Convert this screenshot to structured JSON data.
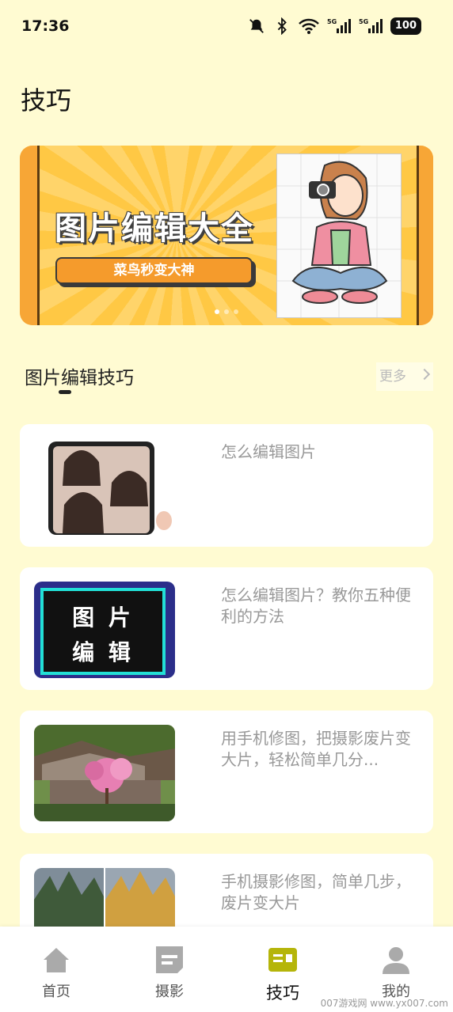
{
  "status": {
    "time": "17:36",
    "battery": "100"
  },
  "page": {
    "title": "技巧"
  },
  "banner": {
    "title": "图片编辑大全",
    "subtitle": "菜鸟秒变大神",
    "dots": 3,
    "active_dot": 0
  },
  "section": {
    "title": "图片编辑技巧",
    "more_label": "更多"
  },
  "articles": [
    {
      "title": "怎么编辑图片"
    },
    {
      "title": "怎么编辑图片？教你五种便利的方法",
      "thumb_text_line1": "图 片",
      "thumb_text_line2": "编 辑"
    },
    {
      "title": "用手机修图，把摄影废片变大片，轻松简单几分..."
    },
    {
      "title": "手机摄影修图，简单几步，废片变大片"
    }
  ],
  "tabs": [
    {
      "label": "首页",
      "icon": "home-icon"
    },
    {
      "label": "摄影",
      "icon": "document-icon"
    },
    {
      "label": "技巧",
      "icon": "tips-icon",
      "active": true
    },
    {
      "label": "我的",
      "icon": "user-icon"
    }
  ],
  "watermark": "007游戏网 www.yx007.com",
  "colors": {
    "accent": "#b5b50a",
    "background": "#fffbd2",
    "banner_orange": "#f59b2c"
  }
}
